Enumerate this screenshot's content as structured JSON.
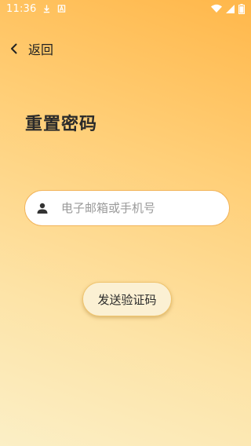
{
  "status_bar": {
    "time": "11:36",
    "icons": [
      "download-icon",
      "a-box-icon",
      "wifi-icon",
      "signal-icon",
      "battery-icon"
    ]
  },
  "header": {
    "back_label": "返回",
    "back_icon": "chevron-left-icon"
  },
  "page": {
    "title": "重置密码"
  },
  "form": {
    "account_input": {
      "icon": "user-icon",
      "value": "",
      "placeholder": "电子邮箱或手机号"
    },
    "send_code_label": "发送验证码"
  },
  "colors": {
    "gradient_top": "#ffb74a",
    "gradient_bottom": "#fbefc6",
    "input_border": "#f2b45a",
    "button_bg": "#fbf0d3"
  }
}
